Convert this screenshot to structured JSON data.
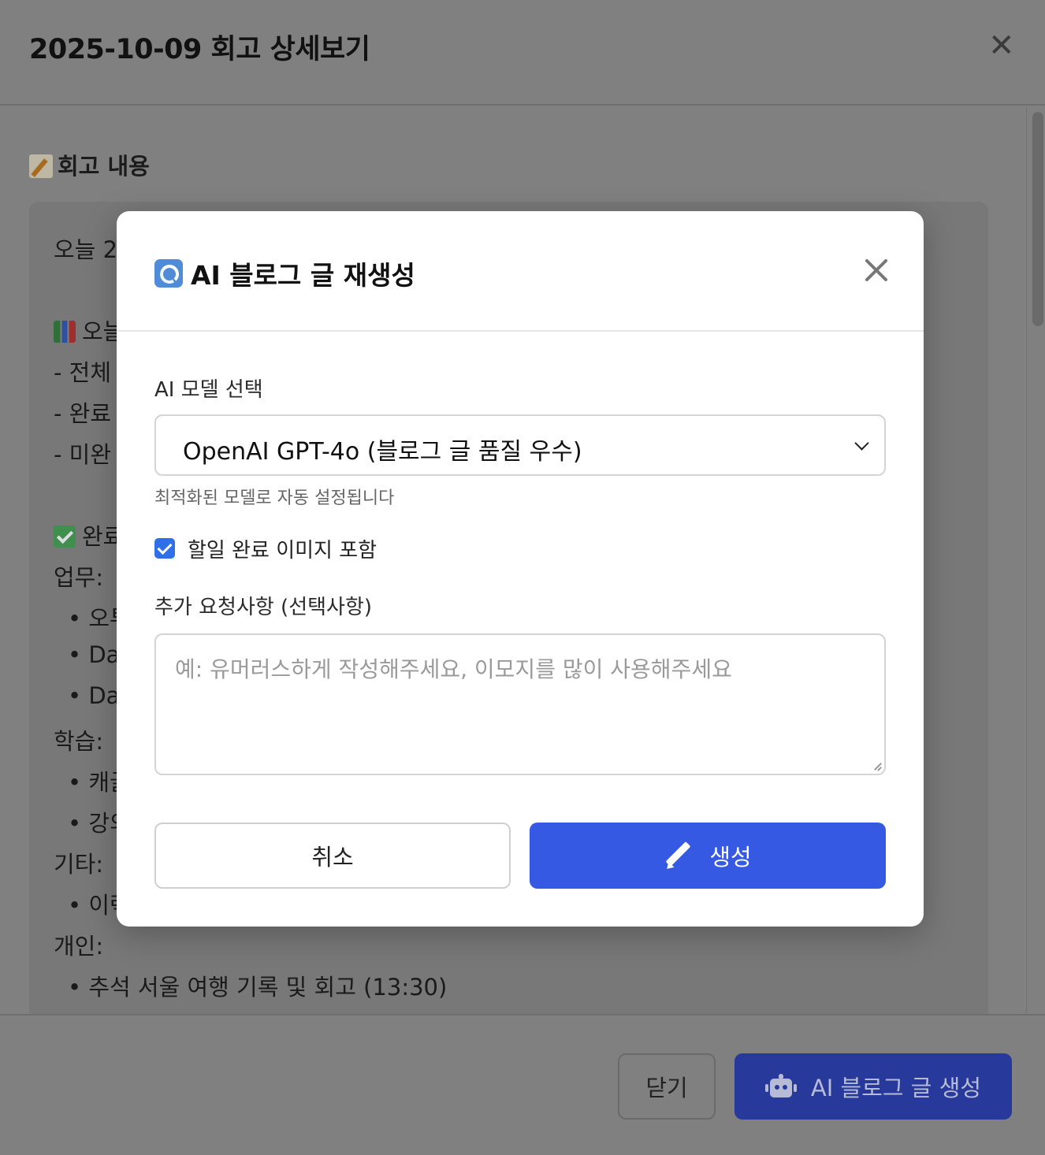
{
  "background": {
    "title": "2025-10-09 회고 상세보기",
    "close_symbol": "✕",
    "section_title": "회고 내용",
    "section_icon": "memo-icon",
    "lines": [
      {
        "text": "오늘 2",
        "icon": null
      },
      {
        "text": "오늘",
        "icon": "bar-chart-icon"
      },
      {
        "text": "- 전체",
        "icon": null
      },
      {
        "text": "- 완료",
        "icon": null
      },
      {
        "text": "- 미완",
        "icon": null
      },
      {
        "text": "완료",
        "icon": "check-mark-icon"
      },
      {
        "text": "업무:",
        "icon": null
      },
      {
        "text": "• 오투",
        "icon": null
      },
      {
        "text": "• Da",
        "icon": null
      },
      {
        "text": "• Da",
        "icon": null
      },
      {
        "text": "학습:",
        "icon": null
      },
      {
        "text": "• 캐글",
        "icon": null
      },
      {
        "text": "• 강의",
        "icon": null
      },
      {
        "text": "기타:",
        "icon": null
      },
      {
        "text": "• 이력",
        "icon": null
      },
      {
        "text": "개인:",
        "icon": null
      },
      {
        "text": "• 추석 서울 여행 기록 및 회고 (13:30)",
        "icon": null
      }
    ],
    "footer": {
      "close_label": "닫기",
      "ai_button_label": "AI 블로그 글 생성",
      "ai_button_icon": "robot-icon"
    }
  },
  "modal": {
    "title": "AI 블로그 글 재생성",
    "title_icon": "refresh-icon",
    "model_label": "AI 모델 선택",
    "model_selected": "OpenAI GPT-4o (블로그 글 품질 우수)",
    "model_help": "최적화된 모델로 자동 설정됩니다",
    "include_image_label": "할일 완료 이미지 포함",
    "include_image_checked": true,
    "extra_label": "추가 요청사항 (선택사항)",
    "extra_placeholder": "예: 유머러스하게 작성해주세요, 이모지를 많이 사용해주세요",
    "extra_value": "",
    "cancel_label": "취소",
    "generate_label": "생성",
    "generate_icon": "pencil-icon"
  },
  "colors": {
    "overlay": "#808080",
    "primary": "#3559e3",
    "checkbox": "#2f6fe8"
  }
}
